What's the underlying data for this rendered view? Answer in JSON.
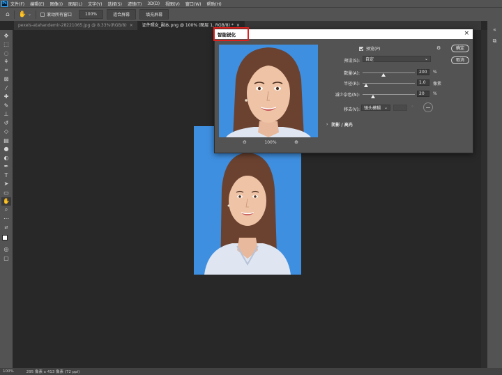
{
  "app": {
    "logo": "Ps"
  },
  "menu": [
    "文件(F)",
    "编辑(E)",
    "图像(I)",
    "图层(L)",
    "文字(Y)",
    "选择(S)",
    "滤镜(T)",
    "3D(D)",
    "视图(V)",
    "窗口(W)",
    "帮助(H)"
  ],
  "options_bar": {
    "scroll_all_label": "滚动所有窗口",
    "zoom_button": "100%",
    "fit_screen_button": "适合屏幕",
    "fill_screen_button": "填充屏幕"
  },
  "tabs": [
    {
      "label": "pexels-atahandemir-28221065.jpg @ 8.33%(RGB/8)",
      "active": false
    },
    {
      "label": "证件照女_副本.png @ 100% (图层 1, RGB/8) *",
      "active": true
    }
  ],
  "status": {
    "zoom": "100%",
    "dimensions": "295 像素 x 413 像素 (72 ppi)"
  },
  "dialog": {
    "title": "智能锐化",
    "preview_label": "预览(P)",
    "preview_checked": true,
    "ok_button": "确定",
    "cancel_button": "取消",
    "preset_label": "预设(S):",
    "preset_value": "自定",
    "amount_label": "数量(A):",
    "amount_value": "200",
    "amount_unit": "%",
    "amount_fraction": 0.4,
    "radius_label": "半径(R):",
    "radius_value": "1.0",
    "radius_unit": "像素",
    "radius_fraction": 0.07,
    "noise_label": "减少杂色(N):",
    "noise_value": "20",
    "noise_unit": "%",
    "noise_fraction": 0.2,
    "remove_label": "移去(V):",
    "remove_value": "镜头模糊",
    "shadows_label": "阴影 / 高光",
    "zoom_level": "100%"
  },
  "colors": {
    "photo_bg": "#3f8fe0",
    "highlight": "#e0201c"
  }
}
